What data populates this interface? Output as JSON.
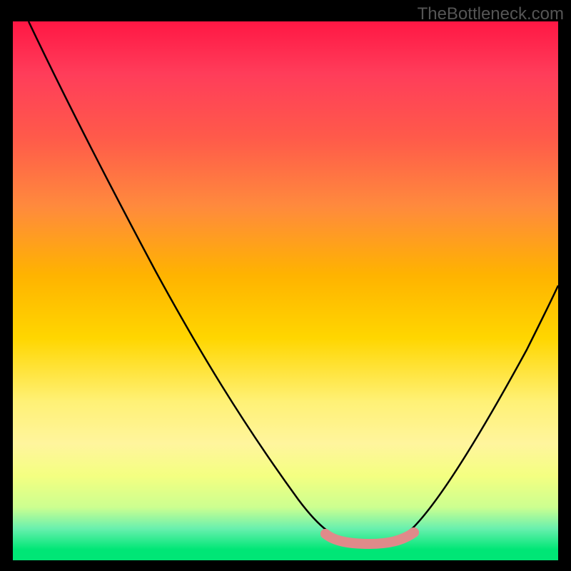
{
  "watermark": "TheBottleneck.com",
  "chart_data": {
    "type": "line",
    "title": "",
    "xlabel": "",
    "ylabel": "",
    "xlim": [
      0,
      100
    ],
    "ylim": [
      0,
      100
    ],
    "series": [
      {
        "name": "bottleneck-curve",
        "x": [
          3,
          10,
          20,
          30,
          40,
          50,
          58,
          62,
          66,
          70,
          74,
          80,
          88,
          96,
          100
        ],
        "y": [
          100,
          88,
          72,
          56,
          40,
          24,
          10,
          4,
          2,
          2,
          4,
          10,
          24,
          40,
          48
        ]
      },
      {
        "name": "highlight-band",
        "x": [
          58,
          62,
          66,
          70,
          74
        ],
        "y": [
          4,
          2,
          2,
          2,
          4
        ]
      }
    ]
  }
}
